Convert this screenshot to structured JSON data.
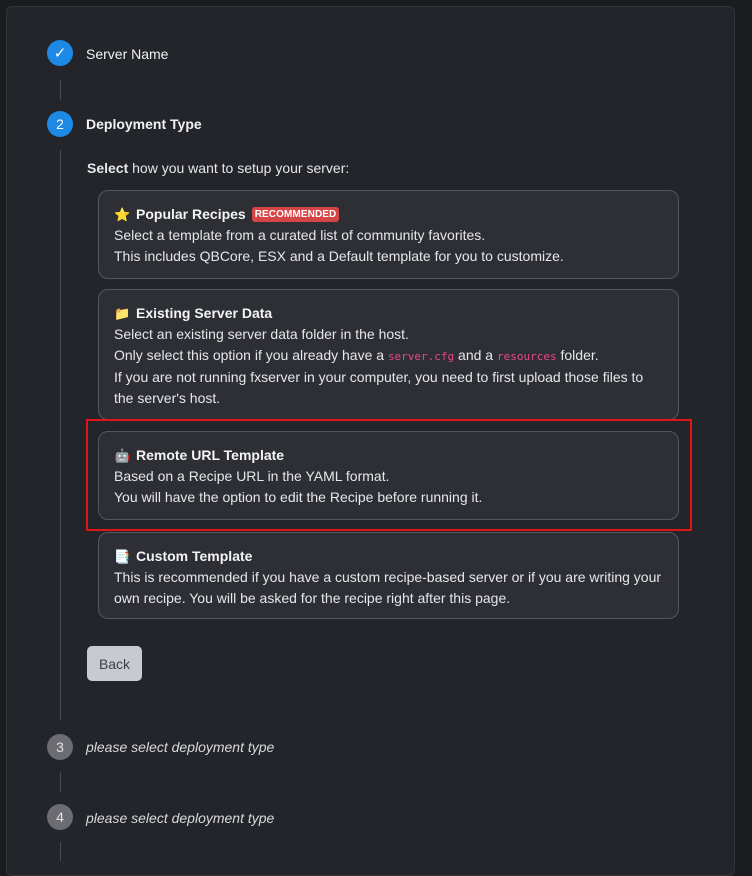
{
  "steps": [
    {
      "number": "✓",
      "title": "Server Name",
      "state": "done"
    },
    {
      "number": "2",
      "title": "Deployment Type",
      "state": "active"
    },
    {
      "number": "3",
      "title": "please select deployment type",
      "state": "pending"
    },
    {
      "number": "4",
      "title": "please select deployment type",
      "state": "pending"
    }
  ],
  "prompt": {
    "bold": "Select",
    "rest": " how you want to setup your server:"
  },
  "cards": [
    {
      "icon": "star-icon",
      "emoji": "⭐",
      "title": "Popular Recipes",
      "badge": "RECOMMENDED",
      "line1": "Select a template from a curated list of community favorites.",
      "line2": "This includes QBCore, ESX and a Default template for you to customize."
    },
    {
      "icon": "folder-icon",
      "emoji": "📁",
      "title": "Existing Server Data",
      "line1": "Select an existing server data folder in the host.",
      "line2_a": "Only select this option if you already have a ",
      "line2_code1": "server.cfg",
      "line2_b": " and a ",
      "line2_code2": "resources",
      "line2_c": " folder.",
      "line3": "If you are not running fxserver in your computer, you need to first upload those files to",
      "line4": "the server's host."
    },
    {
      "icon": "robot-icon",
      "emoji": "🤖",
      "title": "Remote URL Template",
      "line1": "Based on a Recipe URL in the YAML format.",
      "line2": "You will have the option to edit the Recipe before running it."
    },
    {
      "icon": "document-icon",
      "emoji": "📑",
      "title": "Custom Template",
      "line1": "This is recommended if you have a custom recipe-based server or if you are writing your",
      "line2": "own recipe. You will be asked for the recipe right after this page."
    }
  ],
  "back_label": "Back",
  "colors": {
    "accent": "#1e88e5",
    "badge": "#d64545",
    "highlight": "#e01616",
    "code": "#e8488a"
  }
}
